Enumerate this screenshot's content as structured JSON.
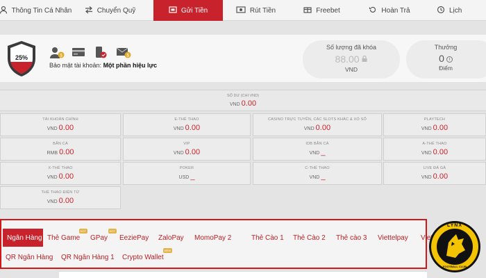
{
  "nav": [
    {
      "label": "Thông Tin Cá Nhân",
      "icon": "user-icon"
    },
    {
      "label": "Chuyển Quỹ",
      "icon": "transfer-icon"
    },
    {
      "label": "Gửi Tiền",
      "icon": "deposit-icon",
      "active": true
    },
    {
      "label": "Rút Tiền",
      "icon": "withdraw-icon"
    },
    {
      "label": "Freebet",
      "icon": "freebet-icon"
    },
    {
      "label": "Hoàn Trả",
      "icon": "refund-icon"
    },
    {
      "label": "Lịch",
      "icon": "history-icon"
    }
  ],
  "security": {
    "level": "25%",
    "label_prefix": "Bảo mật tài khoản:",
    "label_value": "Một phần hiệu lực"
  },
  "locked": {
    "title": "Số lượng đã khóa",
    "value": "88.00",
    "unit": "VND"
  },
  "reward": {
    "title": "Thưởng",
    "value": "0",
    "unit": "Điểm"
  },
  "total": {
    "name": "SỐ DƯ (CHI VND)",
    "currency": "VND",
    "value": "0.00"
  },
  "wallets": [
    {
      "name": "TÀI KHOẢN CHÍNH",
      "currency": "VND",
      "value": "0.00"
    },
    {
      "name": "E-THỂ THAO",
      "currency": "VND",
      "value": "0.00"
    },
    {
      "name": "CASINO TRỰC TUYẾN, CÁC SLOTS KHÁC & XỔ SỐ",
      "currency": "VND",
      "value": "0.00"
    },
    {
      "name": "PLAYTECH",
      "currency": "VND",
      "value": "0.00"
    },
    {
      "name": "BẮN CÁ",
      "currency": "RMB",
      "value": "0.00"
    },
    {
      "name": "VIP",
      "currency": "VND",
      "value": "0.00"
    },
    {
      "name": "IDB BẮN CÁ",
      "currency": "VND",
      "value": "_"
    },
    {
      "name": "A-THỂ THAO",
      "currency": "VND",
      "value": "0.00"
    },
    {
      "name": "X-THỂ THAO",
      "currency": "VND",
      "value": "0.00"
    },
    {
      "name": "POKER",
      "currency": "USD",
      "value": "_"
    },
    {
      "name": "C-THỂ THAO",
      "currency": "VND",
      "value": "_"
    },
    {
      "name": "LIVE ĐÁ GÀ",
      "currency": "VND",
      "value": "0.00"
    },
    {
      "name": "THỂ THAO ĐIỆN TỬ",
      "currency": "VND",
      "value": "0.00"
    }
  ],
  "methods_row1": [
    {
      "label": "Ngân Hàng",
      "active": true
    },
    {
      "label": "Thẻ Game",
      "badge": "HOT"
    },
    {
      "label": "GPay",
      "badge": "HOT"
    },
    {
      "label": "EeziePay"
    },
    {
      "label": "ZaloPay"
    },
    {
      "label": "MomoPay 2"
    },
    {
      "label": "Thẻ Cào 1"
    },
    {
      "label": "Thẻ Cào 2"
    },
    {
      "label": "Thẻ cào 3"
    },
    {
      "label": "Viettelpay"
    },
    {
      "label": "Viette"
    }
  ],
  "methods_row2": [
    {
      "label": "QR Ngân Hàng"
    },
    {
      "label": "QR Ngân Hàng 1"
    },
    {
      "label": "Crypto Wallet",
      "badge": "NEW"
    }
  ],
  "logo": {
    "top_text": "LYNX",
    "bottom_text": "FOOTBALL CLUB"
  },
  "colors": {
    "accent": "#c8232c",
    "highlight_border": "#d01818",
    "logo_yellow": "#f5c400"
  }
}
